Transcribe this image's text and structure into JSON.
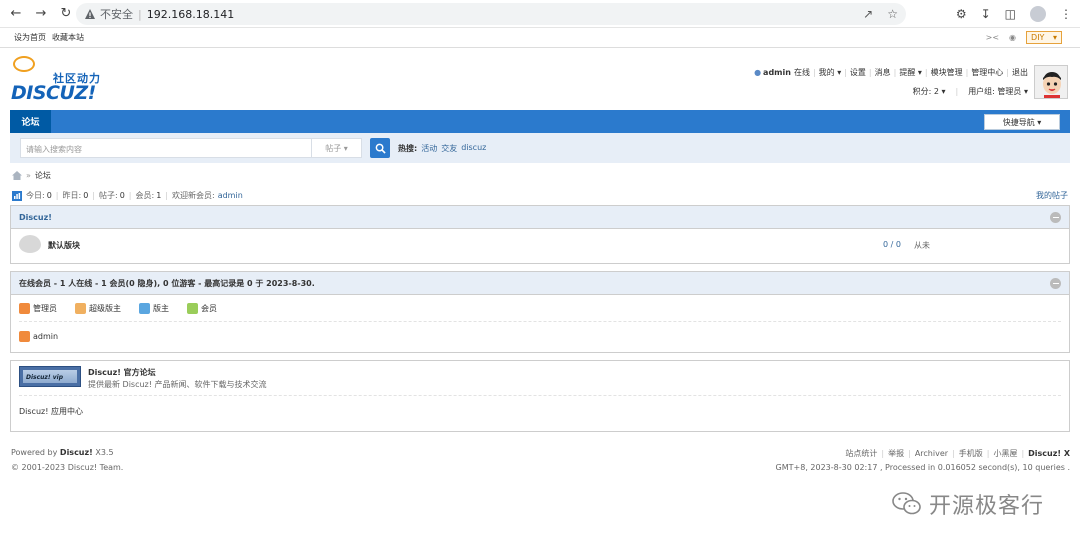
{
  "browser": {
    "insecure_label": "不安全",
    "url": "192.168.18.141"
  },
  "bookmarks": {
    "item1": "设为首页",
    "item2": "收藏本站",
    "diy": "DIY"
  },
  "logo": {
    "cn": "社区动力",
    "en": "DISCUZ!"
  },
  "userbar": {
    "username": "admin",
    "status": "在线",
    "my": "我的",
    "settings": "设置",
    "messages": "消息",
    "reminders": "提醒",
    "module_mgmt": "模块管理",
    "admin_center": "管理中心",
    "logout": "退出",
    "credits": "积分: 2",
    "usergroup": "用户组: 管理员"
  },
  "nav": {
    "forum_tab": "论坛",
    "quick_nav": "快捷导航"
  },
  "search": {
    "placeholder": "请输入搜索内容",
    "type": "帖子",
    "hot_label": "热搜:",
    "hot_keywords": [
      "活动",
      "交友",
      "discuz"
    ]
  },
  "breadcrumb": {
    "current": "论坛"
  },
  "stats": {
    "today_label": "今日:",
    "today": "0",
    "yesterday_label": "昨日:",
    "yesterday": "0",
    "posts_label": "帖子:",
    "posts": "0",
    "members_label": "会员:",
    "members": "1",
    "newest_label": "欢迎新会员:",
    "newest": "admin",
    "my_posts": "我的帖子"
  },
  "category": {
    "title": "Discuz!",
    "forums": [
      {
        "name": "默认版块",
        "count": "0 / 0",
        "last": "从未"
      }
    ]
  },
  "online": {
    "title": "在线会员 - 1 人在线 - 1 会员(0 隐身), 0 位游客 - 最高记录是 0 于 2023-8-30.",
    "legend": [
      {
        "label": "管理员",
        "color": "#f08a3c"
      },
      {
        "label": "超级版主",
        "color": "#f0b060"
      },
      {
        "label": "版主",
        "color": "#5aa6e0"
      },
      {
        "label": "会员",
        "color": "#9acd5a"
      }
    ],
    "member": "admin"
  },
  "links": {
    "vip_badge": "Discuz! vip",
    "title": "Discuz! 官方论坛",
    "desc": "提供最新 Discuz! 产品新闻、软件下载与技术交流",
    "app_center": "Discuz! 应用中心"
  },
  "footer": {
    "powered_by": "Powered by",
    "brand": "Discuz!",
    "version": "X3.5",
    "copyright": "© 2001-2023 Discuz! Team.",
    "links": [
      "站点统计",
      "举报",
      "Archiver",
      "手机版",
      "小黑屋"
    ],
    "brand_right": "Discuz! X",
    "processed": "GMT+8, 2023-8-30 02:17 , Processed in 0.016052 second(s), 10 queries ."
  },
  "watermark": {
    "text": "开源极客行"
  }
}
